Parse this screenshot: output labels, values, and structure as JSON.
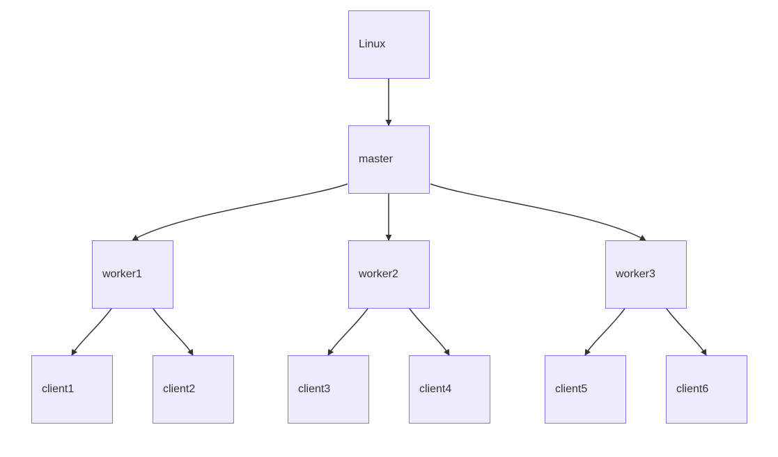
{
  "diagram": {
    "type": "flowchart-tree",
    "nodes": {
      "linux": {
        "label": "Linux"
      },
      "master": {
        "label": "master"
      },
      "worker1": {
        "label": "worker1"
      },
      "worker2": {
        "label": "worker2"
      },
      "worker3": {
        "label": "worker3"
      },
      "client1": {
        "label": "client1"
      },
      "client2": {
        "label": "client2"
      },
      "client3": {
        "label": "client3"
      },
      "client4": {
        "label": "client4"
      },
      "client5": {
        "label": "client5"
      },
      "client6": {
        "label": "client6"
      }
    },
    "edges": [
      {
        "from": "linux",
        "to": "master"
      },
      {
        "from": "master",
        "to": "worker1"
      },
      {
        "from": "master",
        "to": "worker2"
      },
      {
        "from": "master",
        "to": "worker3"
      },
      {
        "from": "worker1",
        "to": "client1"
      },
      {
        "from": "worker1",
        "to": "client2"
      },
      {
        "from": "worker2",
        "to": "client3"
      },
      {
        "from": "worker2",
        "to": "client4"
      },
      {
        "from": "worker3",
        "to": "client5"
      },
      {
        "from": "worker3",
        "to": "client6"
      }
    ],
    "style": {
      "node_fill": "#ECECFF",
      "node_stroke": "#9370DB",
      "edge_color": "#333333"
    }
  }
}
